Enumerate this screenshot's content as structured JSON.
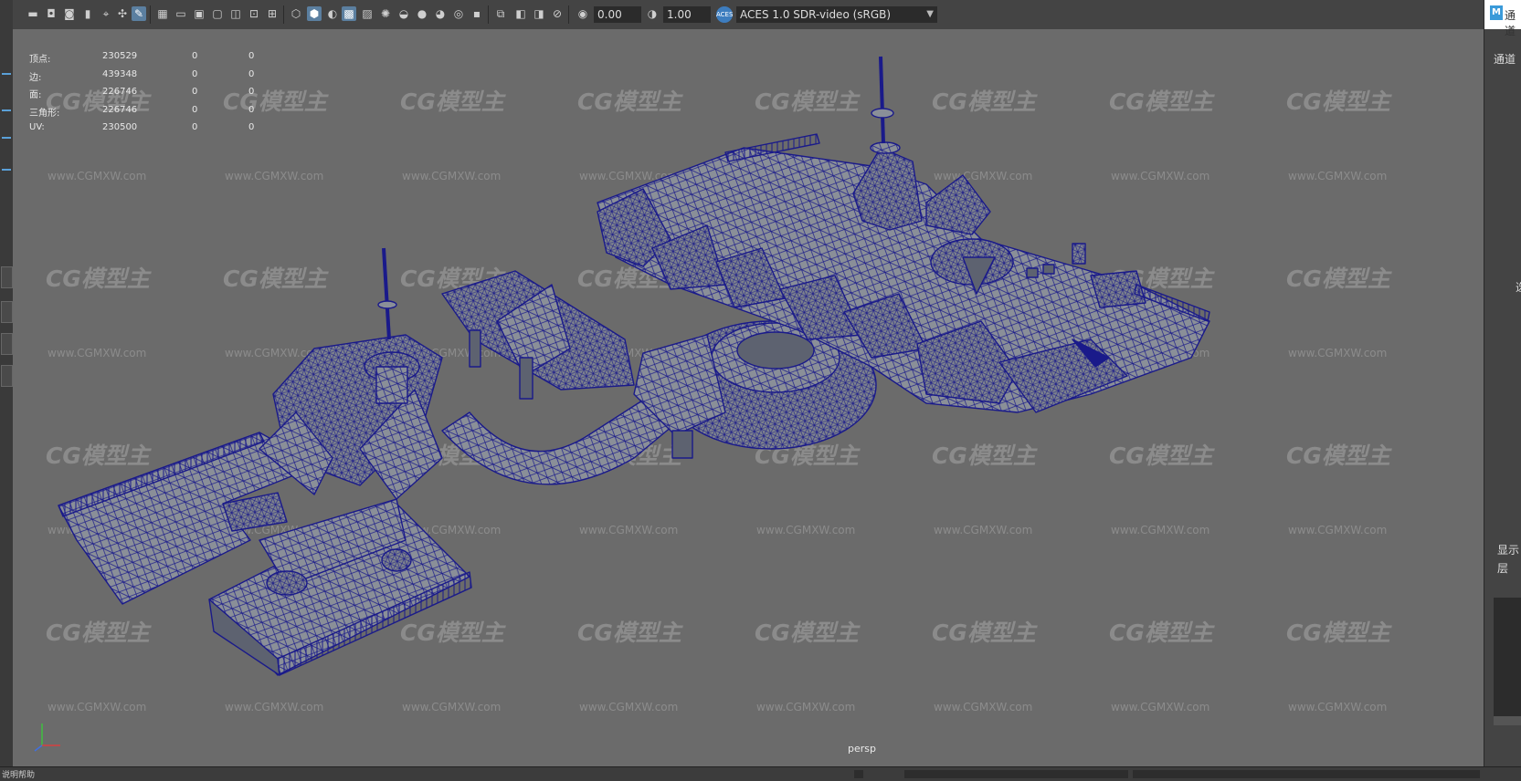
{
  "toolbar": {
    "exposure_value": "0.00",
    "gamma_value": "1.00",
    "colorspace": "ACES 1.0 SDR-video (sRGB)",
    "aces_icon_label": "ACES"
  },
  "hud": {
    "rows": [
      {
        "label": "顶点:",
        "v1": "230529",
        "v2": "0",
        "v3": "0"
      },
      {
        "label": "边:",
        "v1": "439348",
        "v2": "0",
        "v3": "0"
      },
      {
        "label": "面:",
        "v1": "226746",
        "v2": "0",
        "v3": "0"
      },
      {
        "label": "三角形:",
        "v1": "226746",
        "v2": "0",
        "v3": "0"
      },
      {
        "label": "UV:",
        "v1": "230500",
        "v2": "0",
        "v3": "0"
      }
    ]
  },
  "viewport": {
    "camera_label": "persp",
    "watermark_text": "CG模型主",
    "watermark_url": "www.CGMXW.com",
    "wireframe_color": "#1a1a8a",
    "mesh_fill": "#8a8f98"
  },
  "right_panel": {
    "logo": "M",
    "tab_label": "通道",
    "channels_label": "通道",
    "side_char": "选",
    "display_label": "显示",
    "layer_label": "层"
  },
  "bottom_bar": {
    "left_text": "说明帮助"
  }
}
